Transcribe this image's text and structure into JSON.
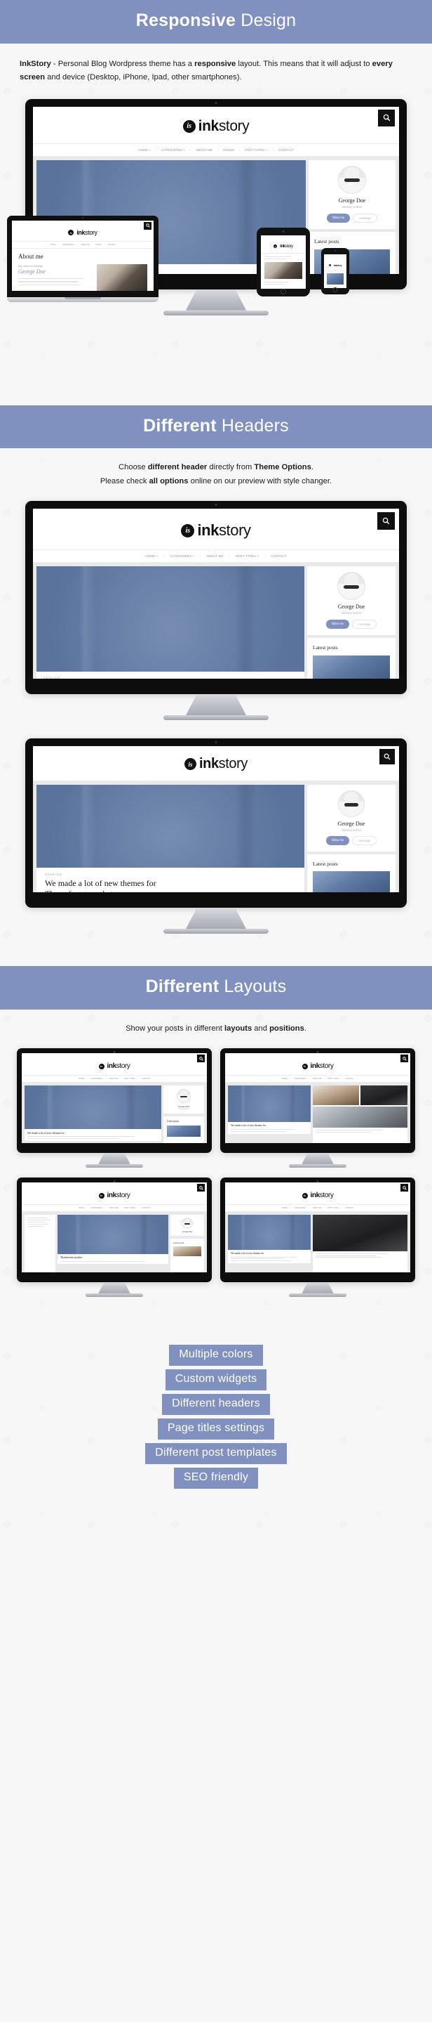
{
  "sections": [
    {
      "id": "responsive",
      "banner_bold": "Responsive",
      "banner_light": " Design",
      "intro_html": "InkStory - Personal Blog Wordpress theme has a responsive layout. This means that it will adjust to every screen and device (Desktop, iPhone, Ipad, other smartphones).",
      "intro_parts": [
        {
          "t": "InkStory",
          "b": true
        },
        {
          "t": " - Personal Blog Wordpress theme has a ",
          "b": false
        },
        {
          "t": "responsive",
          "b": true
        },
        {
          "t": " layout. This means that it will adjust to ",
          "b": false
        },
        {
          "t": "every screen",
          "b": true
        },
        {
          "t": " and device (Desktop, iPhone, Ipad, other smartphones).",
          "b": false
        }
      ]
    },
    {
      "id": "headers",
      "banner_bold": "Different",
      "banner_light": " Headers",
      "intro_parts": [
        {
          "t": "Choose ",
          "b": false
        },
        {
          "t": "different header",
          "b": true
        },
        {
          "t": " directly from ",
          "b": false
        },
        {
          "t": "Theme Options",
          "b": true
        },
        {
          "t": ".",
          "b": false
        },
        {
          "t": "\n",
          "b": false
        },
        {
          "t": "Please check ",
          "b": false
        },
        {
          "t": "all options",
          "b": true
        },
        {
          "t": " online on our preview with style changer.",
          "b": false
        }
      ]
    },
    {
      "id": "layouts",
      "banner_bold": "Different",
      "banner_light": " Layouts",
      "intro_parts": [
        {
          "t": "Show your posts in different ",
          "b": false
        },
        {
          "t": "layouts",
          "b": true
        },
        {
          "t": " and ",
          "b": false
        },
        {
          "t": "positions",
          "b": true
        },
        {
          "t": ".",
          "b": false
        }
      ]
    }
  ],
  "site": {
    "logo_bold": "ink",
    "logo_light": "story",
    "logo_mark": "is",
    "search_icon": "search-icon",
    "nav": [
      {
        "label": "HOME »"
      },
      {
        "label": "CATEGORIES »"
      },
      {
        "label": "ABOUT ME"
      },
      {
        "label": "PAGES"
      },
      {
        "label": "POST TYPES »"
      },
      {
        "label": "CONTACT"
      }
    ],
    "nav_alt": [
      {
        "label": "HOME »"
      },
      {
        "label": "CATEGORIES »"
      },
      {
        "label": "ABOUT ME"
      },
      {
        "label": "POST TYPES »"
      },
      {
        "label": "CONTACT"
      }
    ],
    "author": {
      "name": "George Doe",
      "role": "Inkstory author",
      "follow_label": "follow me",
      "message_label": "message",
      "follow_icon": "user-icon",
      "message_icon": "mail-icon"
    },
    "widgets": {
      "latest_posts_title": "Latest posts"
    },
    "post": {
      "tag": "FASHION",
      "title_line1": "We made a lot of new themes for",
      "title_line2": "Themeforest market",
      "title_full": "We made a lot of new themes for Themeforest market"
    },
    "about": {
      "heading": "About me",
      "sub_small": "My name is George",
      "sub_script": "George Doe"
    }
  },
  "features": {
    "items": [
      {
        "label": "Multiple colors"
      },
      {
        "label": "Custom widgets"
      },
      {
        "label": "Different headers"
      },
      {
        "label": "Page titles settings"
      },
      {
        "label": "Different post templates"
      },
      {
        "label": "SEO friendly"
      }
    ]
  },
  "colors": {
    "accent": "#8090bf",
    "page_bg": "#f7f7f8",
    "bezel": "#0d0d0d",
    "text": "#1d1d1d"
  }
}
